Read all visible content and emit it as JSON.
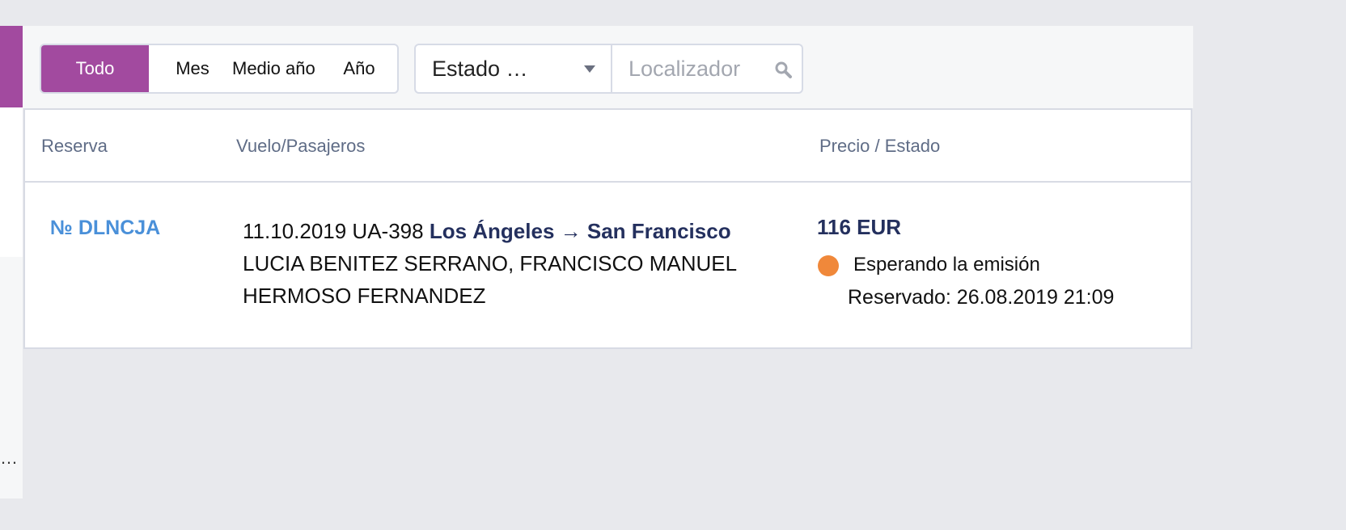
{
  "sidebar": {
    "ellipsis": "…"
  },
  "period_filter": {
    "all_label": "Todo",
    "month_label": "Mes",
    "half_year_label": "Medio año",
    "year_label": "Año"
  },
  "status_filter": {
    "selected": "Estado …"
  },
  "search": {
    "placeholder": "Localizador"
  },
  "table": {
    "headers": {
      "booking": "Reserva",
      "flight": "Vuelo/Pasajeros",
      "price_status": "Precio / Estado"
    },
    "rows": [
      {
        "locator": "№ DLNCJA",
        "flight_info": "11.10.2019 UA-398",
        "route": "Los Ángeles → San Francisco",
        "passengers": "LUCIA BENITEZ SERRANO, FRANCISCO MANUEL HERMOSO FERNANDEZ",
        "price": "116 EUR",
        "status": "Esperando la emisión",
        "reserved": "Reservado: 26.08.2019 21:09"
      }
    ]
  },
  "colors": {
    "accent": "#a24a9f",
    "link": "#4a90d9",
    "navy": "#24305e",
    "status_pending": "#f0883a"
  }
}
